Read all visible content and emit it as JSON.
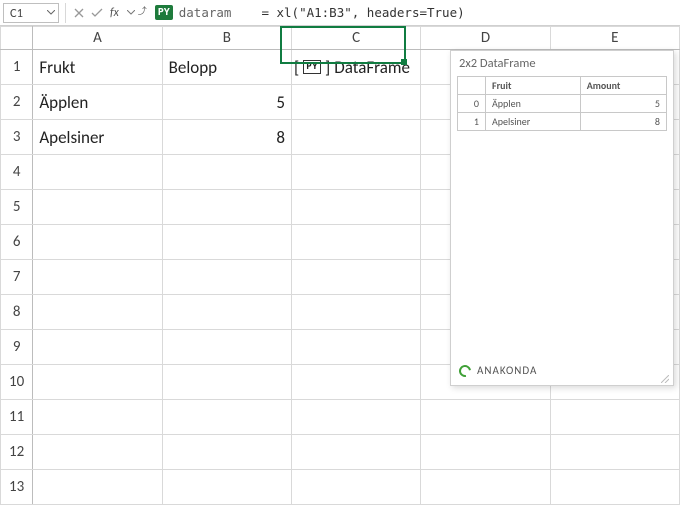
{
  "formula_bar": {
    "name_box": "C1",
    "py_badge": "PY",
    "var_name": "dataram",
    "formula": "= xl(\"A1:B3\", headers=True)"
  },
  "columns": [
    "A",
    "B",
    "C",
    "D",
    "E"
  ],
  "rows": [
    "1",
    "2",
    "3",
    "4",
    "5",
    "6",
    "7",
    "8",
    "9",
    "10",
    "11",
    "12",
    "13"
  ],
  "cells": {
    "A1": "Frukt",
    "B1": "Belopp",
    "A2": "Äpplen",
    "B2": "5",
    "A3": "Apelsiner",
    "B3": "8"
  },
  "c1_token": "PY",
  "c1_label": "DataFrame",
  "card": {
    "title": "2x2 DataFrame",
    "columns": [
      "Fruit",
      "Amount"
    ],
    "rows": [
      {
        "idx": "0",
        "fruit": "Äpplen",
        "amount": "5"
      },
      {
        "idx": "1",
        "fruit": "Apelsiner",
        "amount": "8"
      }
    ],
    "brand": "ANAKONDA"
  },
  "chart_data": {
    "type": "table",
    "title": "2x2 DataFrame",
    "columns": [
      "Fruit",
      "Amount"
    ],
    "rows": [
      [
        "Äpplen",
        5
      ],
      [
        "Apelsiner",
        8
      ]
    ]
  }
}
